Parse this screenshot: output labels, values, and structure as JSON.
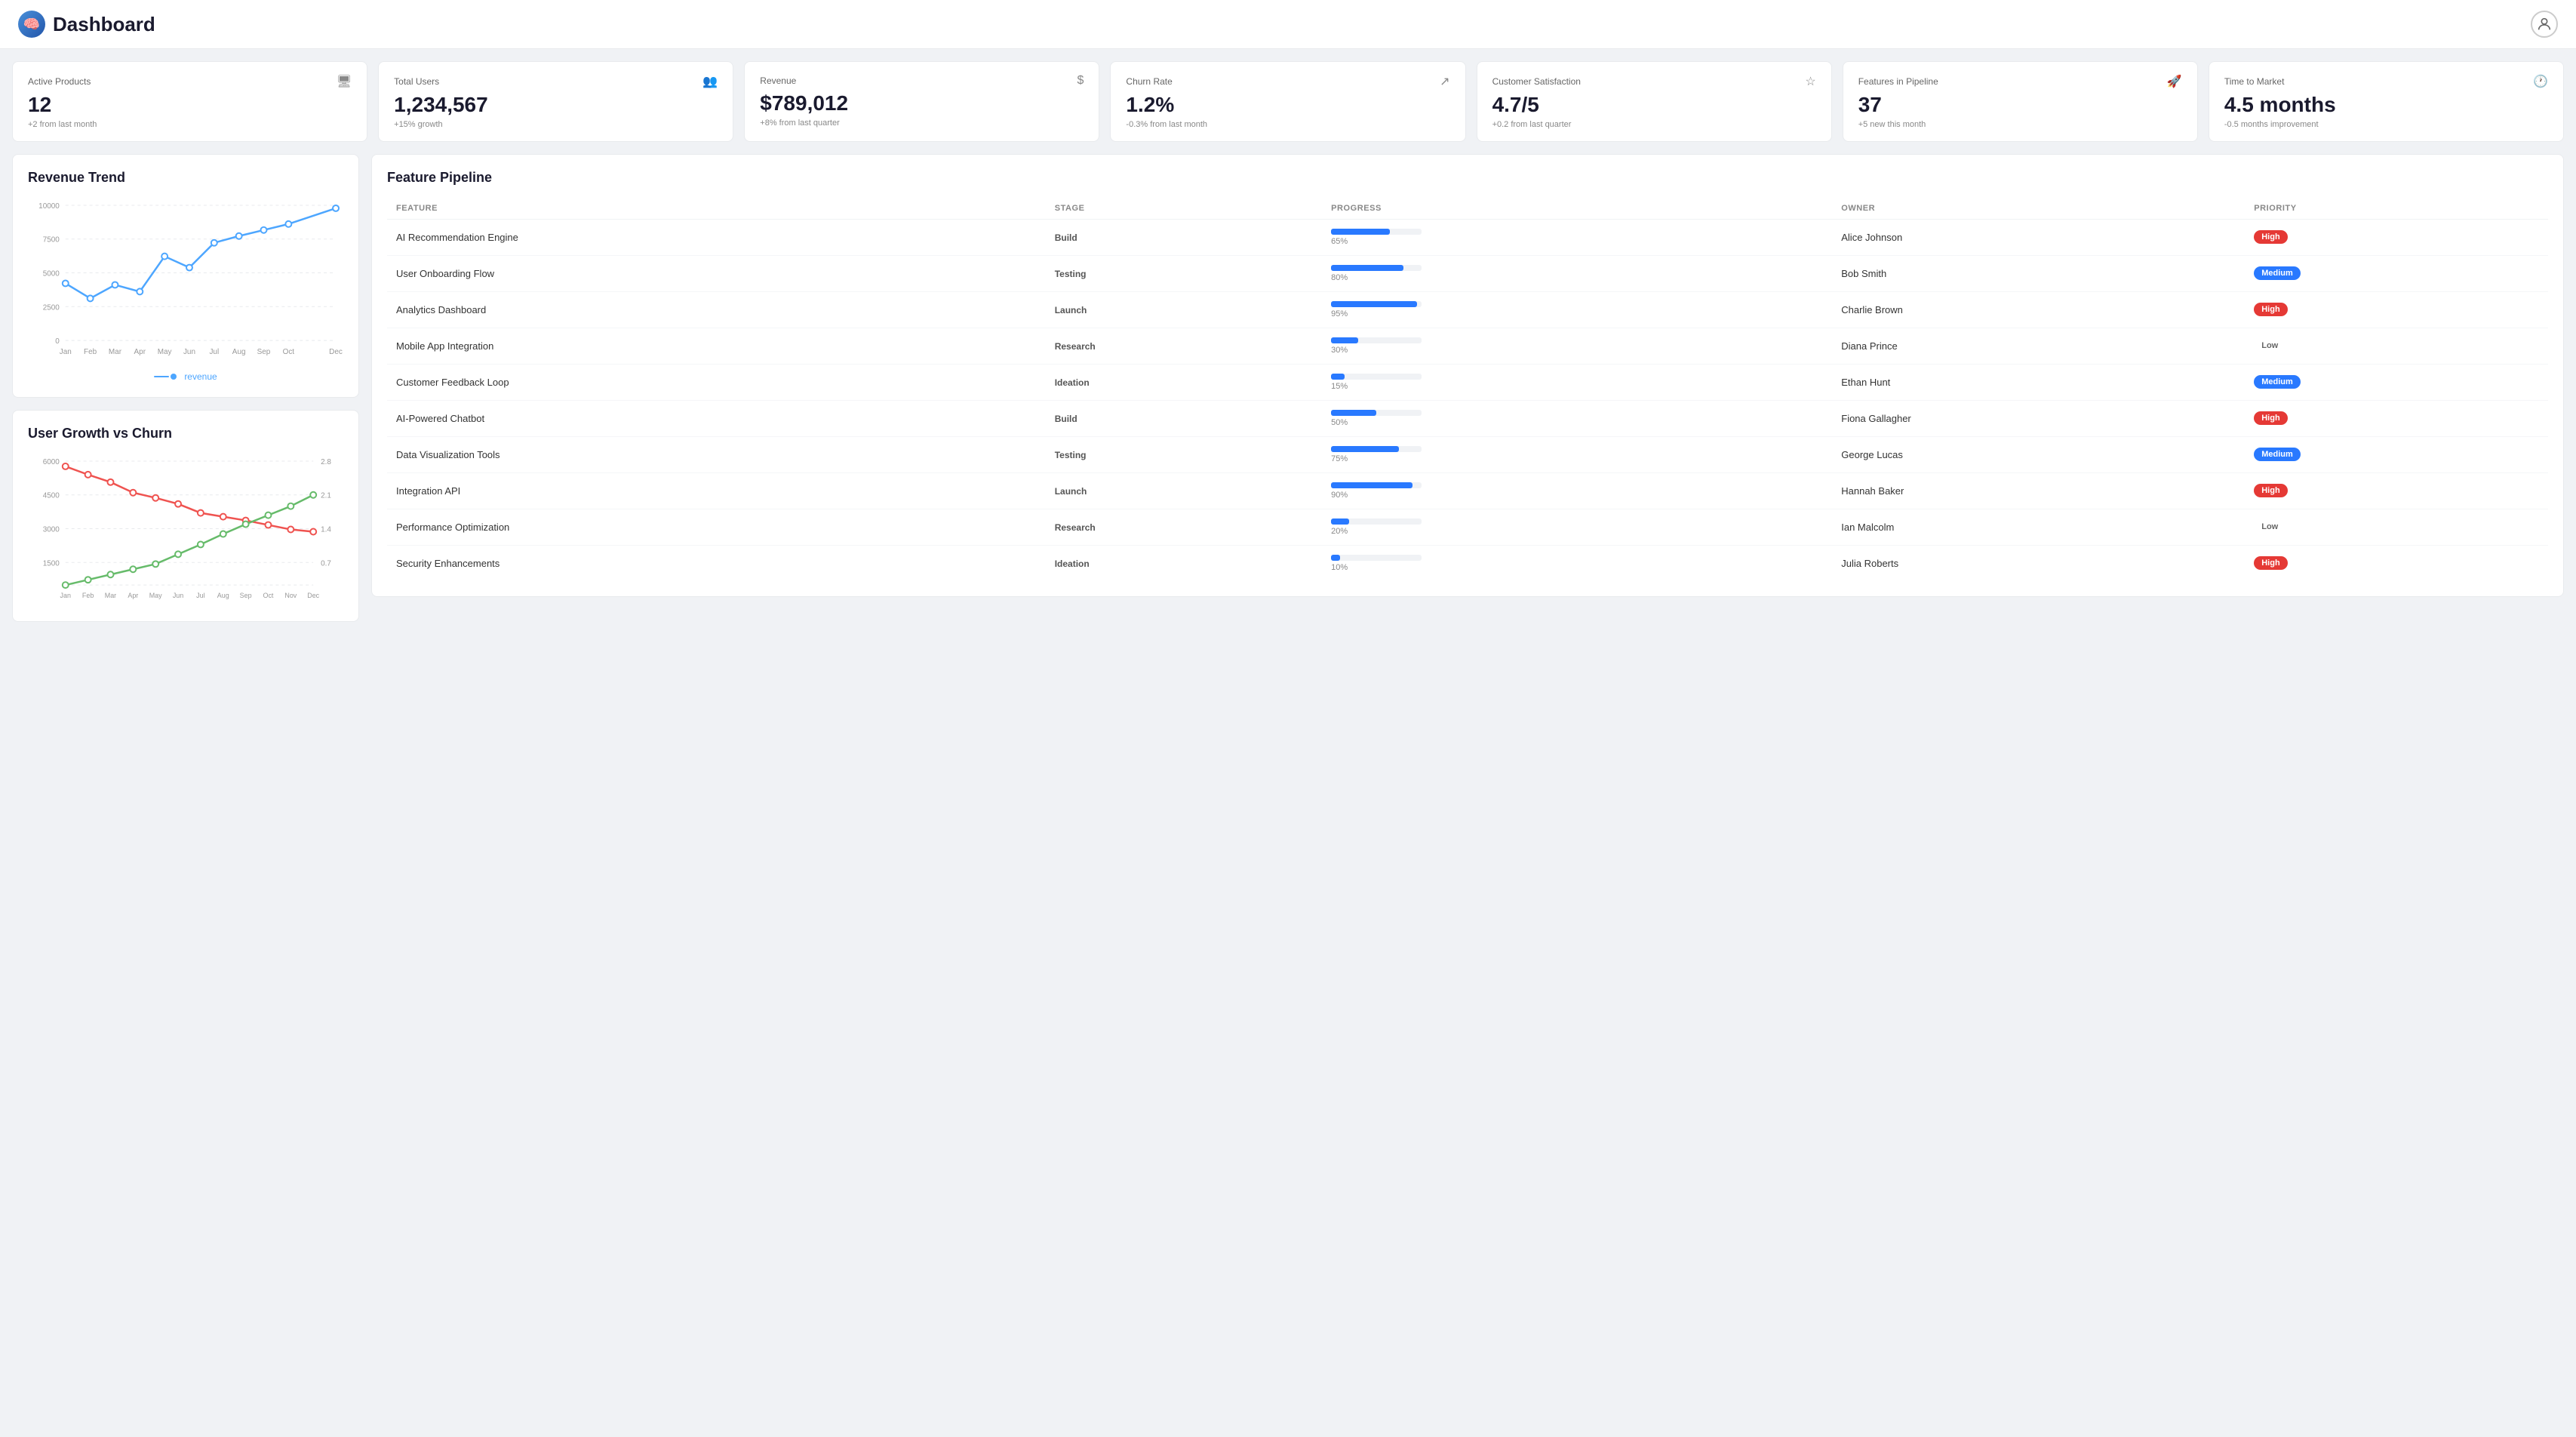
{
  "header": {
    "title": "Dashboard",
    "logo_symbol": "🧠"
  },
  "metrics": [
    {
      "id": "active-products",
      "label": "Active Products",
      "value": "12",
      "change": "+2 from last month",
      "icon": "🖥"
    },
    {
      "id": "total-users",
      "label": "Total Users",
      "value": "1,234,567",
      "change": "+15% growth",
      "icon": "👥"
    },
    {
      "id": "revenue",
      "label": "Revenue",
      "value": "$789,012",
      "change": "+8% from last quarter",
      "icon": "$"
    },
    {
      "id": "churn-rate",
      "label": "Churn Rate",
      "value": "1.2%",
      "change": "-0.3% from last month",
      "icon": "↗"
    },
    {
      "id": "customer-satisfaction",
      "label": "Customer Satisfaction",
      "value": "4.7/5",
      "change": "+0.2 from last quarter",
      "icon": "☆"
    },
    {
      "id": "features-pipeline",
      "label": "Features in Pipeline",
      "value": "37",
      "change": "+5 new this month",
      "icon": "🚀"
    },
    {
      "id": "time-to-market",
      "label": "Time to Market",
      "value": "4.5 months",
      "change": "-0.5 months improvement",
      "icon": "🕐"
    }
  ],
  "revenue_chart": {
    "title": "Revenue Trend",
    "legend_label": "revenue",
    "months": [
      "Jan",
      "Feb",
      "Mar",
      "Apr",
      "May",
      "Jun",
      "Jul",
      "Aug",
      "Sep",
      "Oct",
      "Dec"
    ],
    "values": [
      4200,
      3100,
      4100,
      3600,
      6200,
      5400,
      7200,
      7700,
      8200,
      8600,
      9800
    ],
    "y_labels": [
      "0",
      "2500",
      "5000",
      "7500",
      "10000"
    ]
  },
  "user_growth_chart": {
    "title": "User Growth vs Churn",
    "y_left_labels": [
      "1500",
      "3000",
      "4500",
      "6000"
    ],
    "y_right_labels": [
      "0.7",
      "1.4",
      "2.1",
      "2.8"
    ],
    "months": [
      "Jan",
      "Feb",
      "Mar",
      "Apr",
      "May",
      "Jun",
      "Jul",
      "Aug",
      "Sep",
      "Oct",
      "Nov",
      "Dec"
    ]
  },
  "pipeline": {
    "title": "Feature Pipeline",
    "columns": [
      "FEATURE",
      "STAGE",
      "PROGRESS",
      "OWNER",
      "PRIORITY"
    ],
    "rows": [
      {
        "feature": "AI Recommendation Engine",
        "stage": "Build",
        "progress": 65,
        "owner": "Alice Johnson",
        "priority": "High"
      },
      {
        "feature": "User Onboarding Flow",
        "stage": "Testing",
        "progress": 80,
        "owner": "Bob Smith",
        "priority": "Medium"
      },
      {
        "feature": "Analytics Dashboard",
        "stage": "Launch",
        "progress": 95,
        "owner": "Charlie Brown",
        "priority": "High"
      },
      {
        "feature": "Mobile App Integration",
        "stage": "Research",
        "progress": 30,
        "owner": "Diana Prince",
        "priority": "Low"
      },
      {
        "feature": "Customer Feedback Loop",
        "stage": "Ideation",
        "progress": 15,
        "owner": "Ethan Hunt",
        "priority": "Medium"
      },
      {
        "feature": "AI-Powered Chatbot",
        "stage": "Build",
        "progress": 50,
        "owner": "Fiona Gallagher",
        "priority": "High"
      },
      {
        "feature": "Data Visualization Tools",
        "stage": "Testing",
        "progress": 75,
        "owner": "George Lucas",
        "priority": "Medium"
      },
      {
        "feature": "Integration API",
        "stage": "Launch",
        "progress": 90,
        "owner": "Hannah Baker",
        "priority": "High"
      },
      {
        "feature": "Performance Optimization",
        "stage": "Research",
        "progress": 20,
        "owner": "Ian Malcolm",
        "priority": "Low"
      },
      {
        "feature": "Security Enhancements",
        "stage": "Ideation",
        "progress": 10,
        "owner": "Julia Roberts",
        "priority": "High"
      }
    ]
  }
}
